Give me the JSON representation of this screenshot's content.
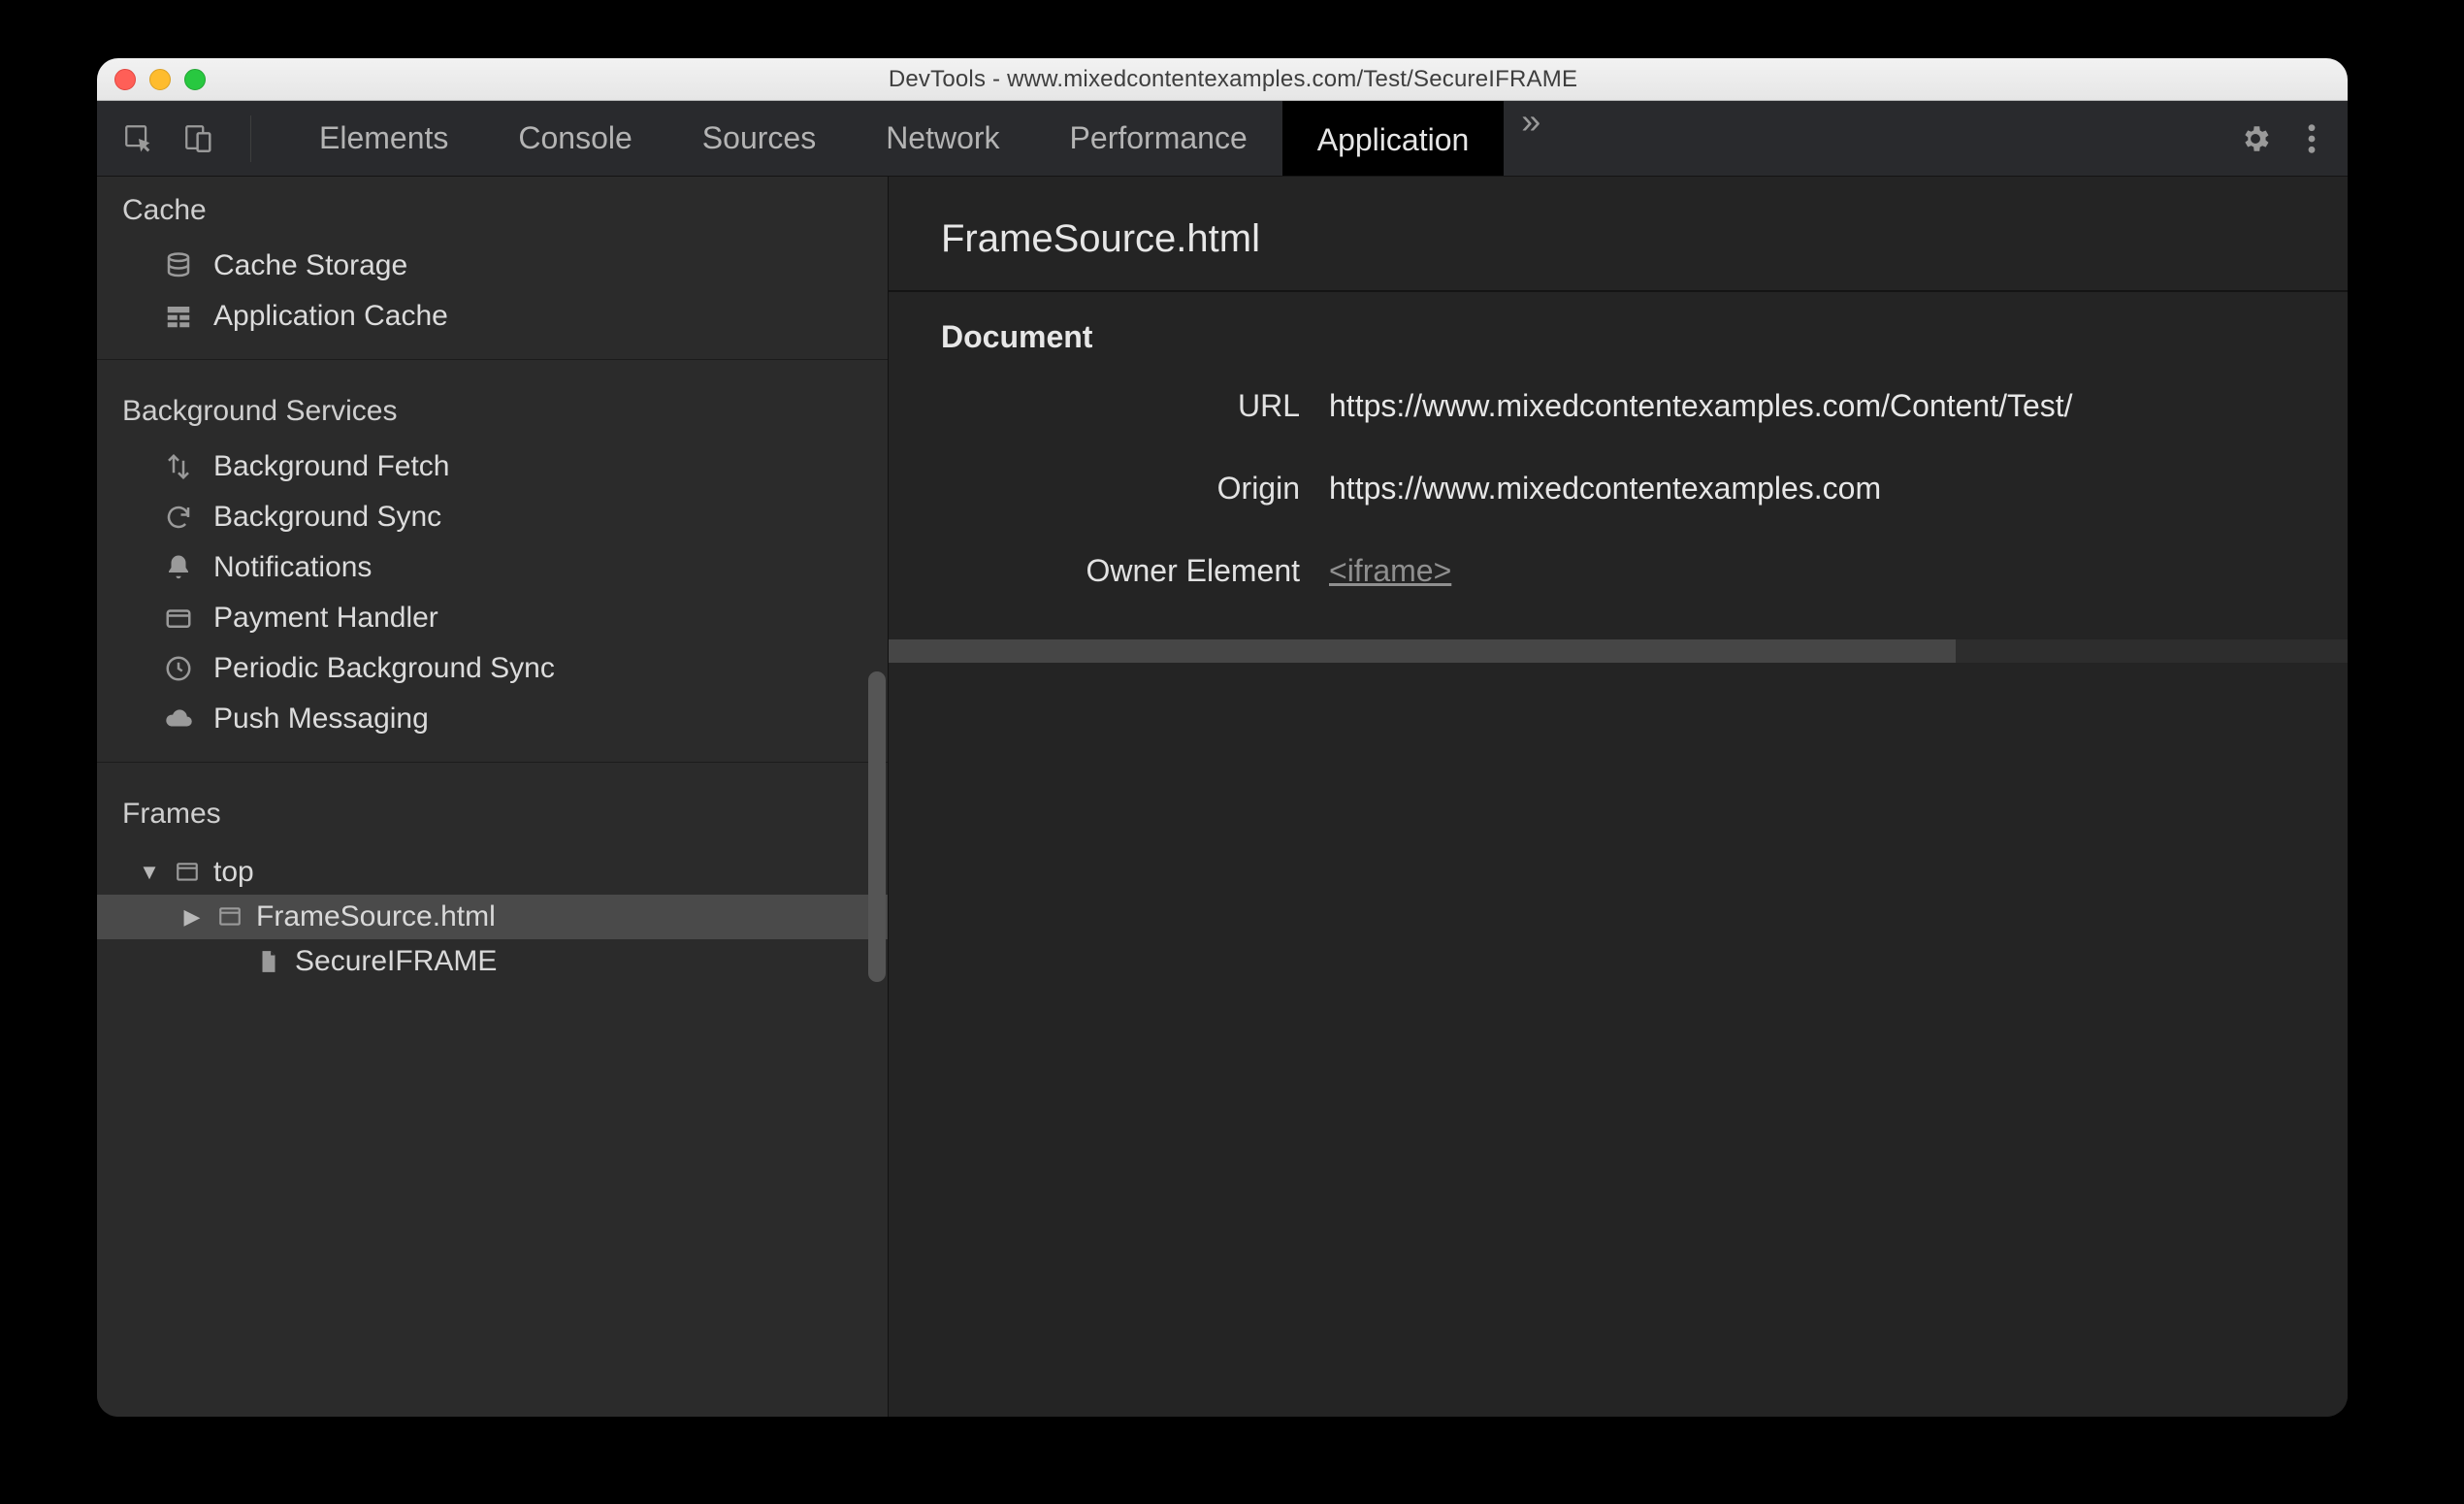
{
  "window": {
    "title": "DevTools - www.mixedcontentexamples.com/Test/SecureIFRAME"
  },
  "tabs": {
    "items": [
      "Elements",
      "Console",
      "Sources",
      "Network",
      "Performance",
      "Application"
    ],
    "active": "Application"
  },
  "sidebar": {
    "cache": {
      "title": "Cache",
      "items": [
        "Cache Storage",
        "Application Cache"
      ]
    },
    "background": {
      "title": "Background Services",
      "items": [
        "Background Fetch",
        "Background Sync",
        "Notifications",
        "Payment Handler",
        "Periodic Background Sync",
        "Push Messaging"
      ]
    },
    "frames": {
      "title": "Frames",
      "top_label": "top",
      "child1": "FrameSource.html",
      "child2": "SecureIFRAME"
    }
  },
  "detail": {
    "heading": "FrameSource.html",
    "doc_section": "Document",
    "url_label": "URL",
    "url_value": "https://www.mixedcontentexamples.com/Content/Test/",
    "origin_label": "Origin",
    "origin_value": "https://www.mixedcontentexamples.com",
    "owner_label": "Owner Element",
    "owner_value": "<iframe>"
  }
}
